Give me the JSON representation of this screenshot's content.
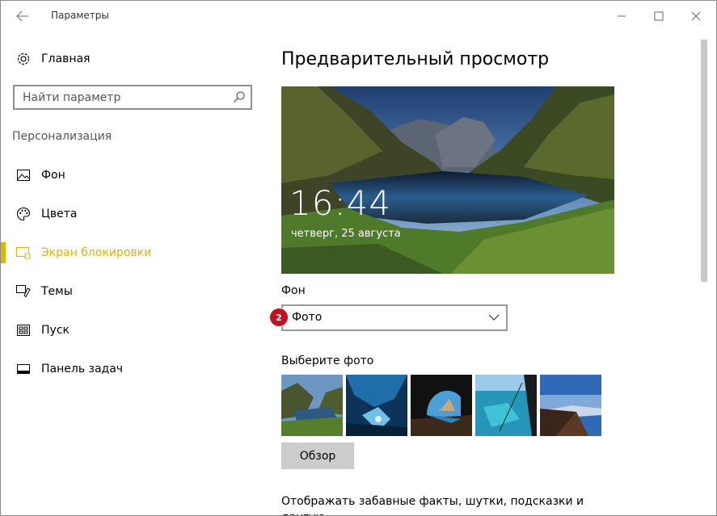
{
  "window": {
    "title": "Параметры"
  },
  "sidebar": {
    "home_label": "Главная",
    "search_placeholder": "Найти параметр",
    "section_label": "Персонализация",
    "items": [
      {
        "label": "Фон",
        "icon": "image-icon"
      },
      {
        "label": "Цвета",
        "icon": "palette-icon"
      },
      {
        "label": "Экран блокировки",
        "icon": "lock-screen-icon",
        "active": true
      },
      {
        "label": "Темы",
        "icon": "themes-icon"
      },
      {
        "label": "Пуск",
        "icon": "start-icon"
      },
      {
        "label": "Панель задач",
        "icon": "taskbar-icon"
      }
    ]
  },
  "main": {
    "title": "Предварительный просмотр",
    "preview": {
      "time": "16:44",
      "date": "четверг, 25 августа"
    },
    "background_label": "Фон",
    "background_value": "Фото",
    "step_badge": "2",
    "choose_photo_label": "Выберите фото",
    "browse_label": "Обзор",
    "description": "Отображать забавные факты, шутки, подсказки и другую"
  },
  "colors": {
    "accent": "#e3b400",
    "badge": "#c1121f",
    "button_bg": "#cccccc"
  }
}
